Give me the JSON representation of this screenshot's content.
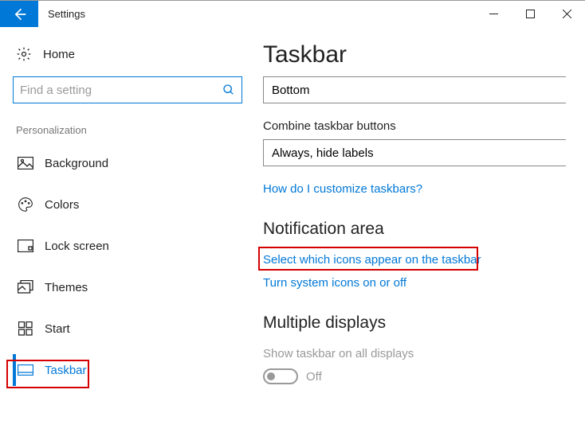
{
  "titlebar": {
    "title": "Settings"
  },
  "sidebar": {
    "home_label": "Home",
    "search_placeholder": "Find a setting",
    "section": "Personalization",
    "items": [
      {
        "label": "Background"
      },
      {
        "label": "Colors"
      },
      {
        "label": "Lock screen"
      },
      {
        "label": "Themes"
      },
      {
        "label": "Start"
      },
      {
        "label": "Taskbar"
      }
    ]
  },
  "main": {
    "title": "Taskbar",
    "location_value": "Bottom",
    "combine_label": "Combine taskbar buttons",
    "combine_value": "Always, hide labels",
    "customize_link": "How do I customize taskbars?",
    "notif_heading": "Notification area",
    "select_icons_link": "Select which icons appear on the taskbar",
    "system_icons_link": "Turn system icons on or off",
    "multi_heading": "Multiple displays",
    "show_all_label": "Show taskbar on all displays",
    "toggle_state": "Off"
  }
}
